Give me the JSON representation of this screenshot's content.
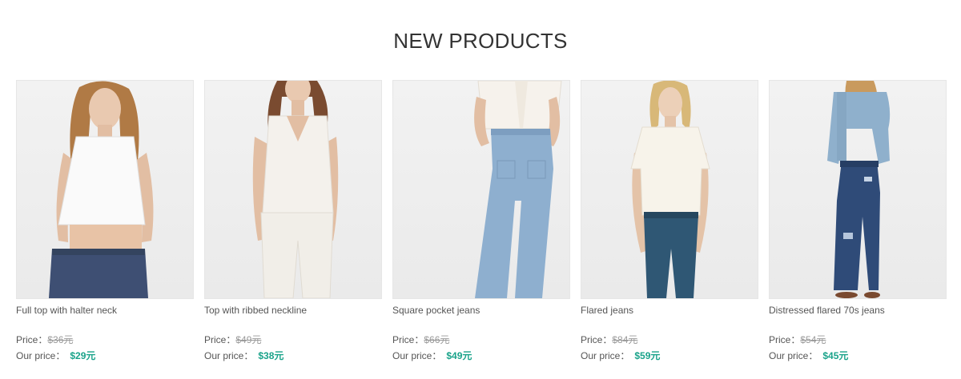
{
  "section": {
    "title": "NEW PRODUCTS"
  },
  "labels": {
    "price": "Price：",
    "our_price": "Our price："
  },
  "products": [
    {
      "name": "Full top with halter neck",
      "old_price": "$36元",
      "our_price": "$29元",
      "image": "woman-white-crop-top-icon"
    },
    {
      "name": "Top with ribbed neckline",
      "old_price": "$49元",
      "our_price": "$38元",
      "image": "woman-white-vneck-top-icon"
    },
    {
      "name": "Square pocket jeans",
      "old_price": "$66元",
      "our_price": "$49元",
      "image": "wide-leg-jeans-icon"
    },
    {
      "name": "Flared jeans",
      "old_price": "$84元",
      "our_price": "$59元",
      "image": "woman-flared-jeans-icon"
    },
    {
      "name": "Distressed flared 70s jeans",
      "old_price": "$54元",
      "our_price": "$45元",
      "image": "woman-denim-shirt-jeans-icon"
    }
  ],
  "colors": {
    "accent": "#1aa38a",
    "title": "#333333",
    "text": "#555555",
    "strike": "#999999"
  }
}
